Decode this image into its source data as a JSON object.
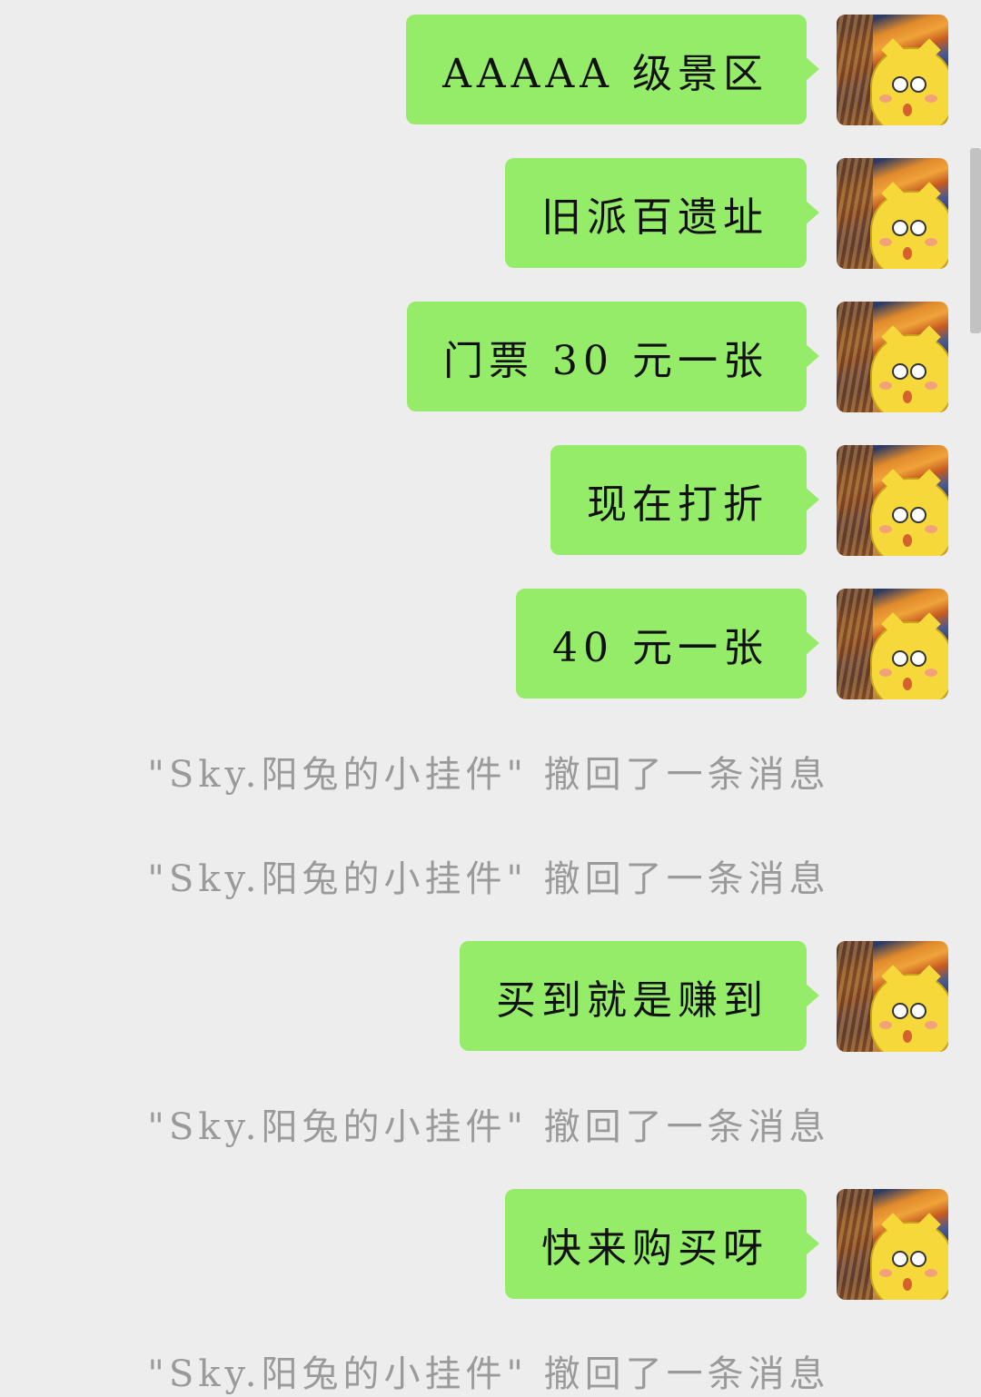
{
  "messages": [
    {
      "type": "bubble",
      "text": "AAAAA 级景区"
    },
    {
      "type": "bubble",
      "text": "旧派百遗址"
    },
    {
      "type": "bubble",
      "text": "门票 30 元一张"
    },
    {
      "type": "bubble",
      "text": "现在打折"
    },
    {
      "type": "bubble",
      "text": "40 元一张"
    },
    {
      "type": "recall",
      "text": "\"Sky.阳兔的小挂件\" 撤回了一条消息"
    },
    {
      "type": "recall",
      "text": "\"Sky.阳兔的小挂件\" 撤回了一条消息"
    },
    {
      "type": "bubble",
      "text": "买到就是赚到"
    },
    {
      "type": "recall",
      "text": "\"Sky.阳兔的小挂件\" 撤回了一条消息"
    },
    {
      "type": "bubble",
      "text": "快来购买呀"
    },
    {
      "type": "recall",
      "text": "\"Sky.阳兔的小挂件\" 撤回了一条消息"
    }
  ],
  "colors": {
    "background": "#ededed",
    "bubble": "#95ec69",
    "recall_text": "#9a9a9a"
  },
  "avatar": {
    "icon": "avatar-scream-cat-icon"
  }
}
